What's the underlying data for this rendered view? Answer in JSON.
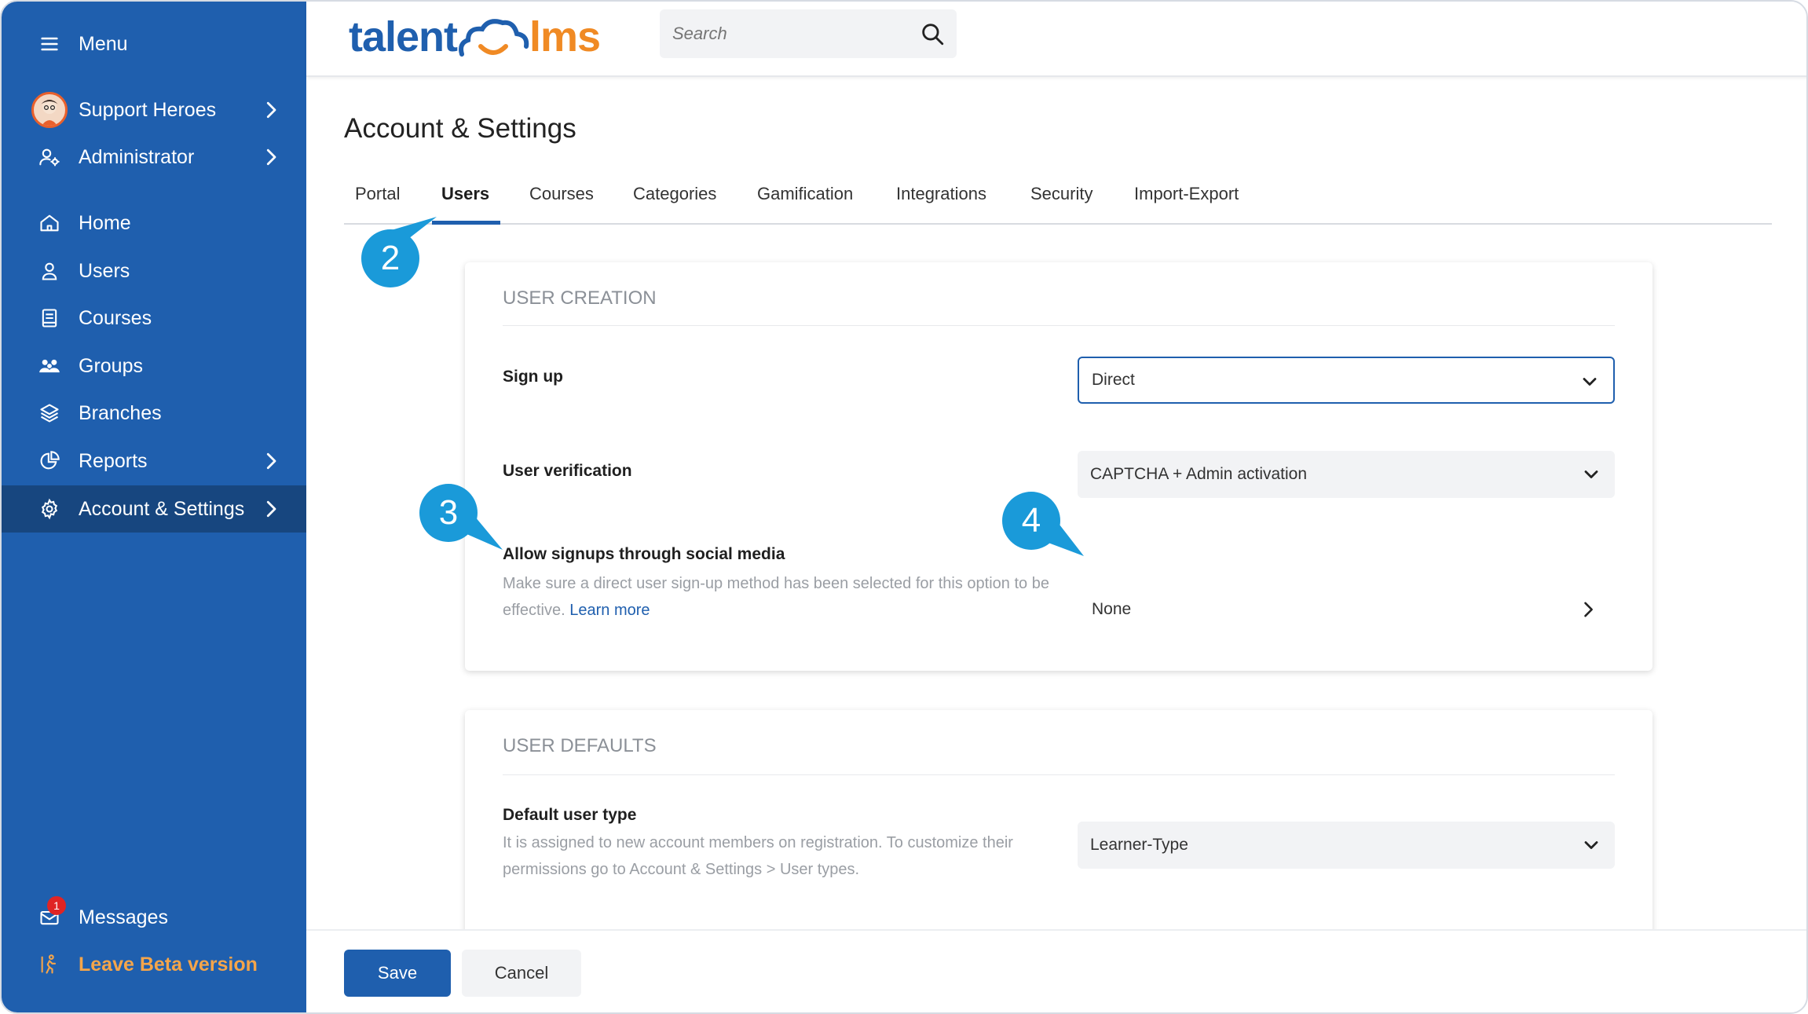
{
  "sidebar": {
    "menu_label": "Menu",
    "account_label": "Support Heroes",
    "role_label": "Administrator",
    "items": [
      {
        "label": "Home",
        "icon": "home-icon"
      },
      {
        "label": "Users",
        "icon": "user-icon"
      },
      {
        "label": "Courses",
        "icon": "book-icon"
      },
      {
        "label": "Groups",
        "icon": "group-icon"
      },
      {
        "label": "Branches",
        "icon": "layers-icon"
      },
      {
        "label": "Reports",
        "icon": "pie-chart-icon"
      },
      {
        "label": "Account & Settings",
        "icon": "gear-icon"
      }
    ],
    "messages_label": "Messages",
    "messages_count": "1",
    "beta_label": "Leave Beta version"
  },
  "header": {
    "logo_part1": "talent",
    "logo_part2": "lms",
    "search_placeholder": "Search"
  },
  "page": {
    "title": "Account & Settings",
    "tabs": [
      "Portal",
      "Users",
      "Courses",
      "Categories",
      "Gamification",
      "Integrations",
      "Security",
      "Import-Export"
    ],
    "active_tab": "Users"
  },
  "user_creation": {
    "title": "USER CREATION",
    "signup_label": "Sign up",
    "signup_value": "Direct",
    "verification_label": "User verification",
    "verification_value": "CAPTCHA + Admin activation",
    "social_label": "Allow signups through social media",
    "social_help": "Make sure a direct user sign-up method has been selected for this option to be effective.",
    "social_link": "Learn more",
    "social_value": "None"
  },
  "user_defaults": {
    "title": "USER DEFAULTS",
    "type_label": "Default user type",
    "type_help": "It is assigned to new account members on registration. To customize their permissions go to Account & Settings > User types.",
    "type_value": "Learner-Type"
  },
  "callouts": [
    "2",
    "3",
    "4"
  ],
  "footer": {
    "save_label": "Save",
    "cancel_label": "Cancel"
  },
  "colors": {
    "sidebar": "#1f5fae",
    "sidebar_active": "#17467f",
    "accent": "#1f5fae",
    "callout": "#1a9ad9",
    "beta": "#f5a54a"
  }
}
